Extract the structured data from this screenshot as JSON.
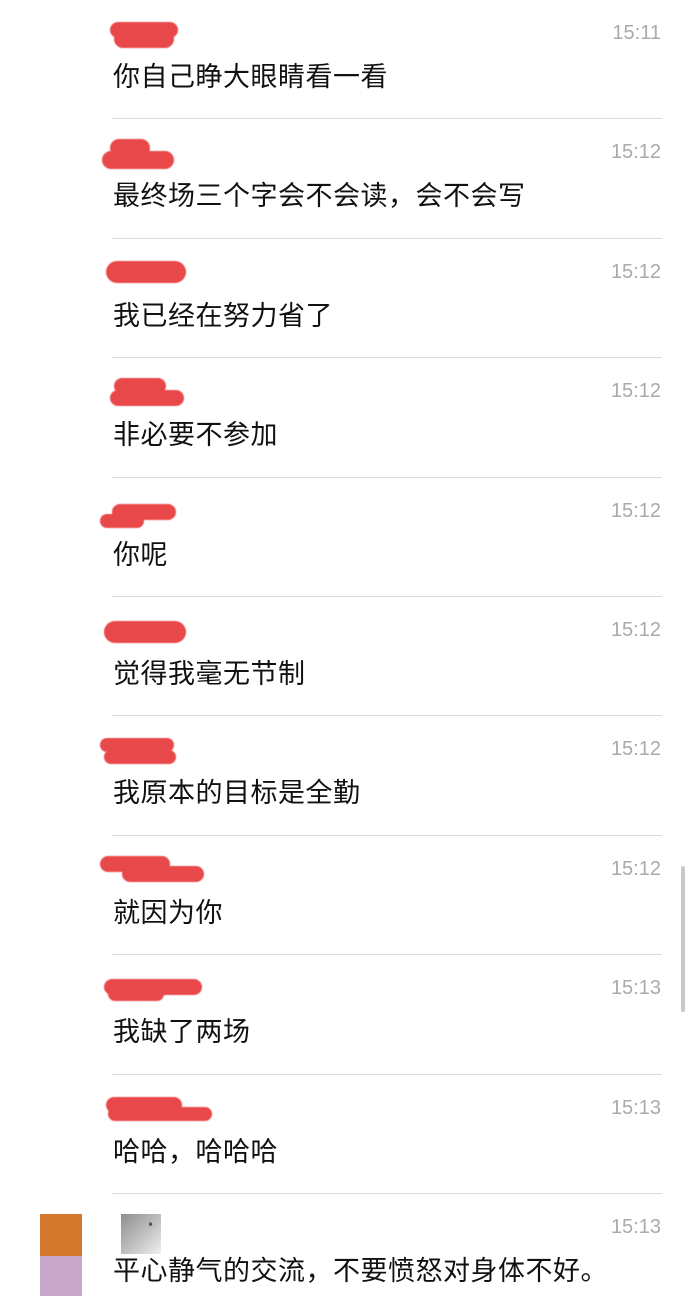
{
  "messages": [
    {
      "text": "你自己睁大眼睛看一看",
      "time": "15:11"
    },
    {
      "text": "最终场三个字会不会读，会不会写",
      "time": "15:12"
    },
    {
      "text": "我已经在努力省了",
      "time": "15:12"
    },
    {
      "text": "非必要不参加",
      "time": "15:12"
    },
    {
      "text": "你呢",
      "time": "15:12"
    },
    {
      "text": "觉得我毫无节制",
      "time": "15:12"
    },
    {
      "text": "我原本的目标是全勤",
      "time": "15:12"
    },
    {
      "text": "就因为你",
      "time": "15:12"
    },
    {
      "text": "我缺了两场",
      "time": "15:13"
    },
    {
      "text": "哈哈，哈哈哈",
      "time": "15:13"
    },
    {
      "text": "平心静气的交流，不要愤怒对身体不好。",
      "time": "15:13"
    }
  ],
  "colors": {
    "redaction": "#e8484a",
    "timestamp": "#aaaaaa",
    "divider": "#dcdcdc"
  }
}
